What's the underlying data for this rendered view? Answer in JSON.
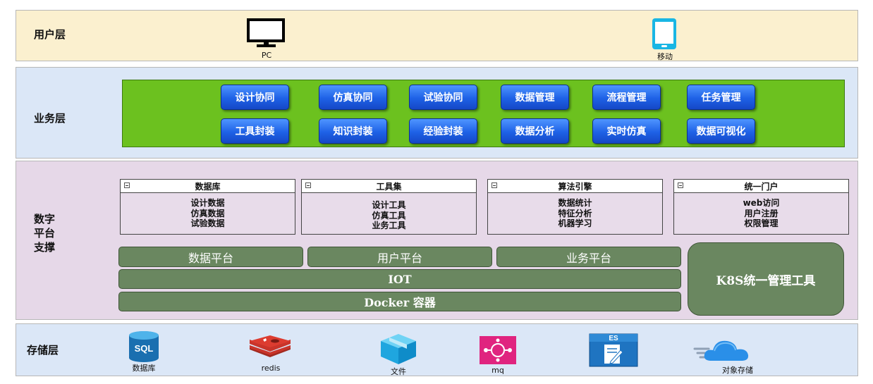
{
  "user_layer": {
    "title": "用户层",
    "devices": [
      {
        "label": "PC",
        "icon": "pc-monitor-icon"
      },
      {
        "label": "移动",
        "icon": "mobile-phone-icon"
      }
    ]
  },
  "business_layer": {
    "title": "业务层",
    "row1": [
      "设计协同",
      "仿真协同",
      "试验协同",
      "数据管理",
      "流程管理",
      "任务管理"
    ],
    "row2": [
      "工具封装",
      "知识封装",
      "经验封装",
      "数据分析",
      "实时仿真",
      "数据可视化"
    ]
  },
  "platform_layer": {
    "title_lines": [
      "数字",
      "平台",
      "支撑"
    ],
    "modules": [
      {
        "title": "数据库",
        "items": [
          "设计数据",
          "仿真数据",
          "试验数据"
        ]
      },
      {
        "title": "工具集",
        "items": [
          "设计工具",
          "仿真工具",
          "业务工具"
        ]
      },
      {
        "title": "算法引擎",
        "items": [
          "数据统计",
          "特征分析",
          "机器学习"
        ]
      },
      {
        "title": "统一门户",
        "items": [
          "web访问",
          "用户注册",
          "权限管理"
        ]
      }
    ],
    "platforms": [
      "数据平台",
      "用户平台",
      "业务平台"
    ],
    "iot": "IOT",
    "docker": "Docker 容器",
    "k8s": "K8S统一管理工具"
  },
  "storage_layer": {
    "title": "存储层",
    "items": [
      {
        "label": "数据库",
        "icon": "sql-database-icon",
        "icon_text": "SQL"
      },
      {
        "label": "redis",
        "icon": "redis-icon"
      },
      {
        "label": "文件",
        "icon": "file-box-icon"
      },
      {
        "label": "mq",
        "icon": "message-queue-icon"
      },
      {
        "label": "",
        "icon": "elasticsearch-icon",
        "icon_text": "ES"
      },
      {
        "label": "对象存储",
        "icon": "object-storage-cloud-icon"
      }
    ]
  },
  "colors": {
    "user_bg": "#fbf0cf",
    "business_bg": "#dbe7f7",
    "business_panel": "#6cc11f",
    "button_blue": "#1e61e6",
    "platform_bg": "#e6d8e8",
    "bar_green": "#6a8760",
    "storage_bg": "#dbe7f7"
  }
}
